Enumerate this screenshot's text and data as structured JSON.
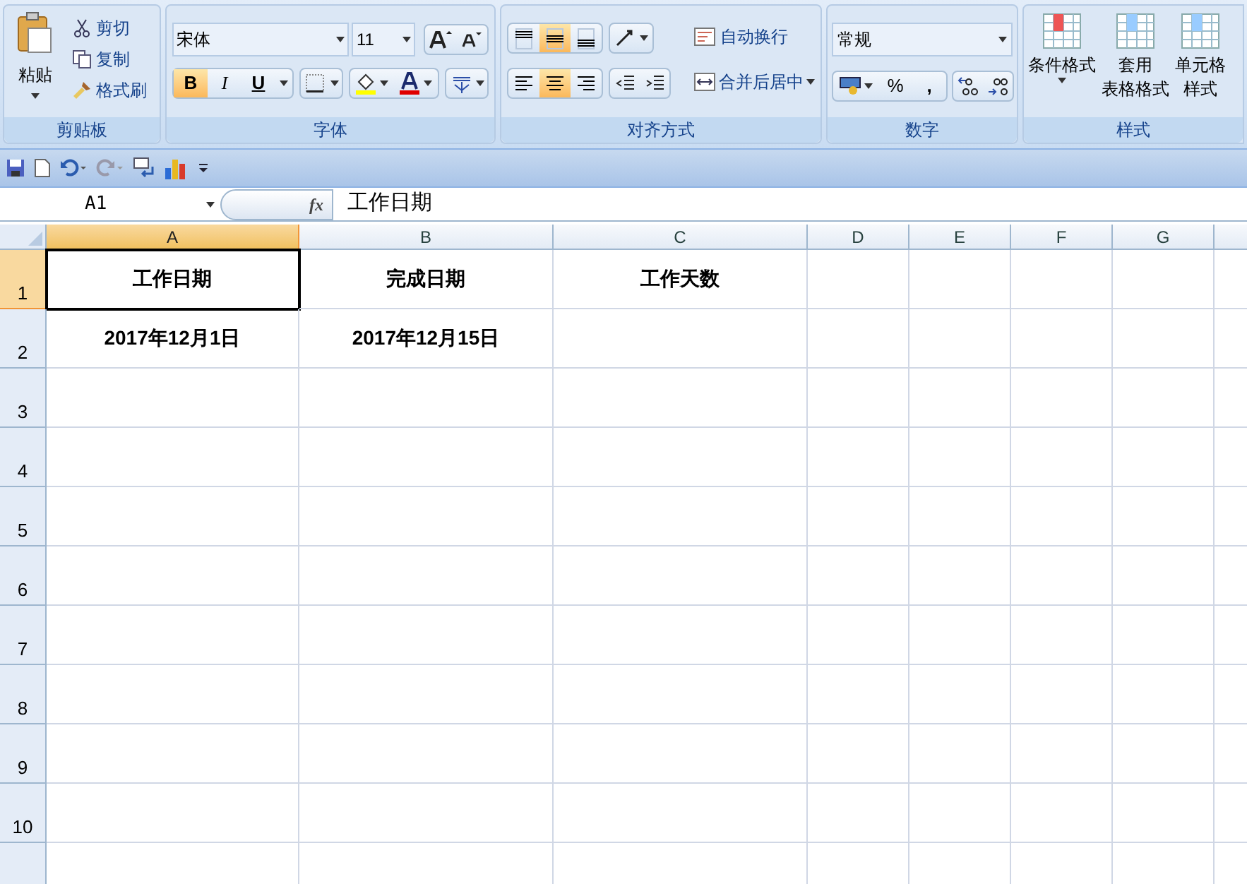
{
  "ribbon": {
    "clipboard": {
      "paste": "粘贴",
      "items": [
        {
          "kind": "cut",
          "label": "剪切"
        },
        {
          "kind": "copy",
          "label": "复制"
        },
        {
          "kind": "brush",
          "label": "格式刷"
        }
      ],
      "label": "剪贴板"
    },
    "font": {
      "font_name": "宋体",
      "font_size": "11",
      "styles": [
        {
          "label": "B",
          "selected": true
        },
        {
          "label": "I",
          "selected": false
        },
        {
          "label": "U",
          "selected": false
        }
      ],
      "label": "字体"
    },
    "alignment": {
      "vertical": [
        {
          "kind": "top",
          "selected": false
        },
        {
          "kind": "middle",
          "selected": true
        },
        {
          "kind": "bottom",
          "selected": false
        }
      ],
      "horizontal": [
        {
          "kind": "left",
          "selected": false
        },
        {
          "kind": "center",
          "selected": true
        },
        {
          "kind": "right",
          "selected": false
        }
      ],
      "wrap": "自动换行",
      "merge": "合并后居中",
      "label": "对齐方式"
    },
    "number": {
      "format": "常规",
      "percent": "%",
      "comma": ",",
      "label": "数字"
    },
    "styles": {
      "buttons": [
        {
          "lines": [
            "条件格式"
          ]
        },
        {
          "lines": [
            "套用",
            "表格格式"
          ]
        },
        {
          "lines": [
            "单元格",
            "样式"
          ]
        }
      ],
      "label": "样式"
    }
  },
  "formula_bar": {
    "name_box": "A1",
    "fx": "fx",
    "formula": "工作日期"
  },
  "columns": [
    {
      "label": "A",
      "selected": true
    },
    {
      "label": "B",
      "selected": false
    },
    {
      "label": "C",
      "selected": false
    },
    {
      "label": "D",
      "selected": false
    },
    {
      "label": "E",
      "selected": false
    },
    {
      "label": "F",
      "selected": false
    },
    {
      "label": "G",
      "selected": false
    }
  ],
  "rows": [
    {
      "label": "1",
      "selected": true,
      "cells": [
        {
          "text": "工作日期",
          "selected": true
        },
        {
          "text": "完成日期",
          "selected": false
        },
        {
          "text": "工作天数",
          "selected": false
        }
      ]
    },
    {
      "label": "2",
      "selected": false,
      "cells": [
        {
          "text": "2017年12月1日",
          "selected": false
        },
        {
          "text": "2017年12月15日",
          "selected": false
        }
      ]
    },
    {
      "label": "3",
      "selected": false,
      "cells": []
    },
    {
      "label": "4",
      "selected": false,
      "cells": []
    },
    {
      "label": "5",
      "selected": false,
      "cells": []
    },
    {
      "label": "6",
      "selected": false,
      "cells": []
    },
    {
      "label": "7",
      "selected": false,
      "cells": []
    },
    {
      "label": "8",
      "selected": false,
      "cells": []
    },
    {
      "label": "9",
      "selected": false,
      "cells": []
    },
    {
      "label": "10",
      "selected": false,
      "cells": []
    }
  ]
}
